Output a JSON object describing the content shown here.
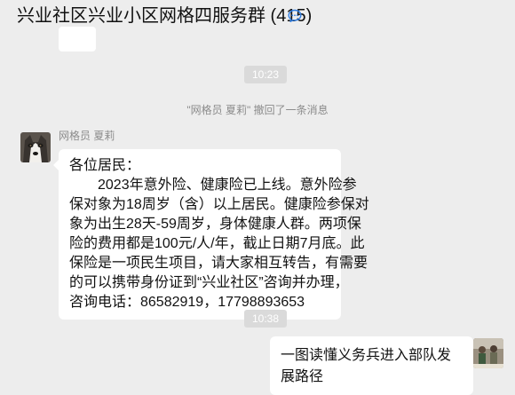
{
  "header": {
    "title": "兴业社区兴业小区网格四服务群 (415)",
    "icon": "chat-bubble-icon",
    "icon_color": "#2f7de1"
  },
  "chat": {
    "time_1": "10:23",
    "recall_notice": "\"网格员 夏莉\" 撤回了一条消息",
    "message_1": {
      "sender": "网格员 夏莉",
      "lines": [
        "各位居民：",
        "　　2023年意外险、健康险已上线。意外险参",
        "保对象为18周岁（含）以上居民。健康险参保对",
        "象为出生28天-59周岁，身体健康人群。两项保",
        "险的费用都是100元/人/年，截止日期7月底。此",
        "保险是一项民生项目，请大家相互转告，有需要",
        "的可以携带身份证到“兴业社区”咨询并办理，",
        "咨询电话：86582919，17798893653"
      ]
    },
    "time_2": "10:38",
    "message_2": {
      "text": "一图读懂义务兵进入部队发展路径"
    }
  },
  "colors": {
    "background": "#ededed",
    "bubble": "#ffffff",
    "meta_text": "#8c8c8c"
  }
}
